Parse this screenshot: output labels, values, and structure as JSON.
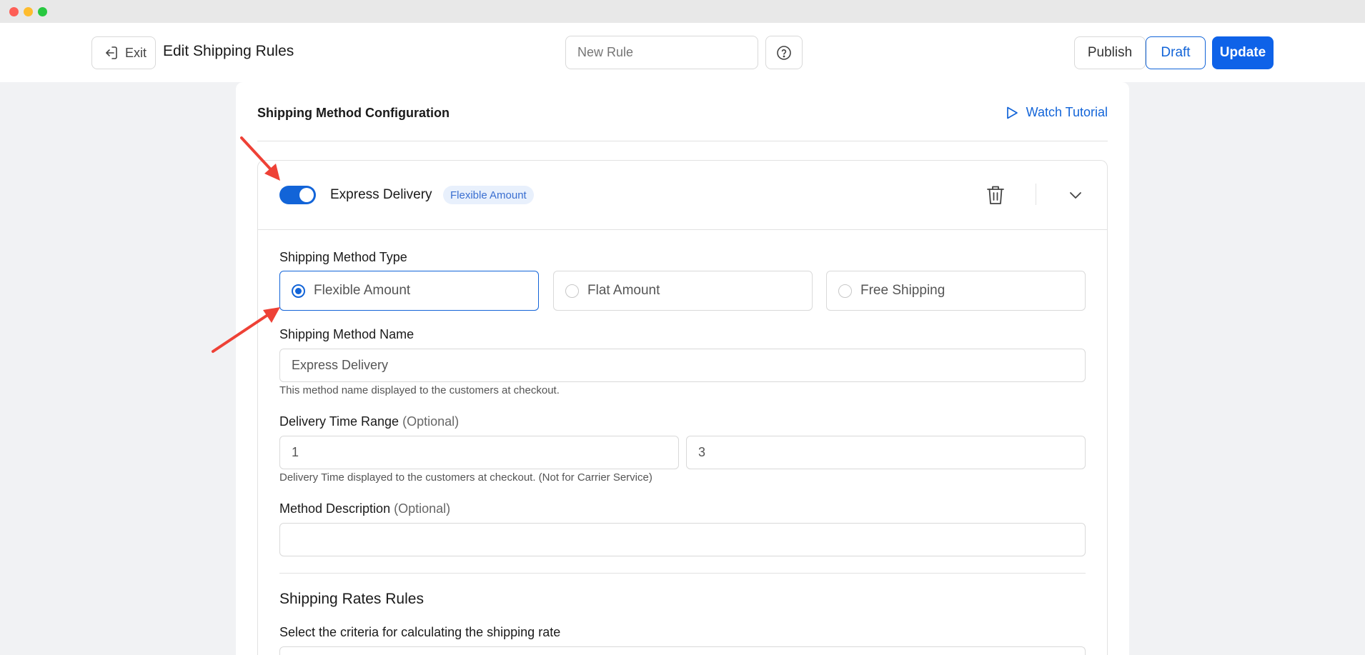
{
  "topbar": {
    "exit_label": "Exit",
    "page_title": "Edit Shipping Rules",
    "rule_name_placeholder": "New Rule",
    "publish_label": "Publish",
    "draft_label": "Draft",
    "update_label": "Update"
  },
  "config": {
    "title": "Shipping Method Configuration",
    "tutorial_label": "Watch Tutorial"
  },
  "method": {
    "enabled": true,
    "name": "Express Delivery",
    "badge": "Flexible Amount",
    "type_label": "Shipping Method Type",
    "types": [
      {
        "label": "Flexible Amount",
        "selected": true
      },
      {
        "label": "Flat Amount",
        "selected": false
      },
      {
        "label": "Free Shipping",
        "selected": false
      }
    ],
    "name_label": "Shipping Method Name",
    "name_value": "Express Delivery",
    "name_hint": "This method name displayed to the customers at checkout.",
    "delivery_label": "Delivery Time Range",
    "optional_tag": "(Optional)",
    "delivery_min": "1",
    "delivery_max": "3",
    "delivery_hint": "Delivery Time displayed to the customers at checkout. (Not for Carrier Service)",
    "description_label": "Method Description",
    "description_value": "",
    "rates_title": "Shipping Rates Rules",
    "criteria_label": "Select the criteria for calculating the shipping rate"
  },
  "colors": {
    "accent": "#1264d8",
    "annotation_arrow": "#ee4136"
  },
  "icons": [
    "exit-icon",
    "help-circle-icon",
    "play-icon",
    "trash-icon",
    "chevron-down-icon"
  ]
}
